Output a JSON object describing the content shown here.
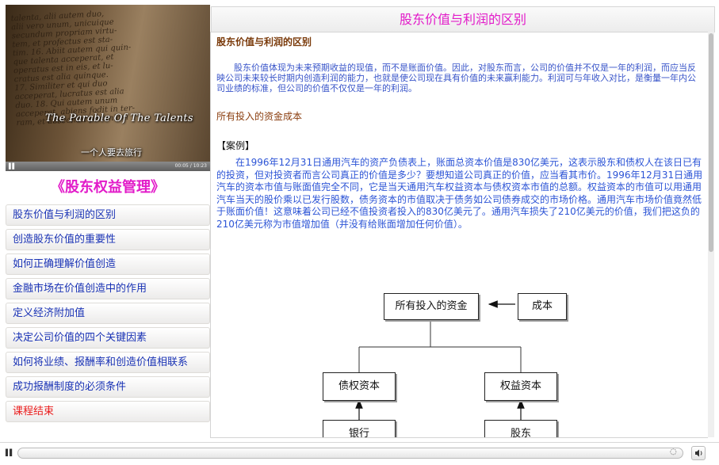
{
  "video": {
    "book_text": [
      "talenta, alii autem duo,",
      "alii vero unum, unicuique",
      "secundum propriam virtu-",
      "tem, et profectus est sta-",
      "tim. 16. Abiit autem qui quin-",
      "que talenta acceperat, et",
      "operatus est in eis, et lu-",
      "cratus est alia quinque.",
      "17. Similiter et qui duo",
      "acceperat, lucratus est alia",
      "duo. 18. Qui autem unum",
      "acceperat, abiens fodit in ter-",
      "ram, et abscondit pecuniam"
    ],
    "caption_en": "The Parable Of The Talents",
    "caption_cn": "一个人要去旅行",
    "time": "00:05 / 10:23"
  },
  "course_title": "《股东权益管理》",
  "menu": [
    {
      "label": "股东价值与利润的区别",
      "current": false
    },
    {
      "label": "创造股东价值的重要性",
      "current": false
    },
    {
      "label": "如何正确理解价值创造",
      "current": false
    },
    {
      "label": "金融市场在价值创造中的作用",
      "current": false
    },
    {
      "label": "定义经济附加值",
      "current": false
    },
    {
      "label": "决定公司价值的四个关键因素",
      "current": false
    },
    {
      "label": "如何将业绩、报酬率和创造价值相联系",
      "current": false
    },
    {
      "label": "成功报酬制度的必须条件",
      "current": false
    },
    {
      "label": "课程结束",
      "current": true
    }
  ],
  "header_title": "股东价值与利润的区别",
  "content": {
    "section_title": "股东价值与利润的区别",
    "para1": "股东价值体现为未来预期收益的现值，而不是账面价值。因此，对股东而言，公司的价值并不仅是一年的利润，而应当反映公司未来较长时期内创造利润的能力，也就是使公司现在具有价值的未来赢利能力。利润可与年收入对比，是衡量一年内公司业绩的标准，但公司的价值不仅仅是一年的利润。",
    "subheading": "所有投入的资金成本",
    "case_label": "【案例】",
    "para2": "在1996年12月31日通用汽车的资产负债表上，账面总资本价值是830亿美元，这表示股东和债权人在该日已有的投资，但对投资者而言公司真正的价值是多少？要想知道公司真正的价值，应当看其市价。1996年12月31日通用汽车的资本市值与账面值完全不同，它是当天通用汽车权益资本与债权资本市值的总额。权益资本的市值可以用通用汽车当天的股价乘以已发行股数，债务资本的市值取决于债务如公司债券成交的市场价格。通用汽车市场价值竟然低于账面价值！这意味着公司已经不值投资者投入的830亿美元了。通用汽车损失了210亿美元的价值，我们把这负的210亿美元称为市值增加值（并没有给账面增加任何价值）。",
    "diagram": {
      "top": "所有投入的资金",
      "cost": "成本",
      "debt": "债权资本",
      "equity": "权益资本",
      "bank": "银行",
      "shareholder": "股东"
    }
  },
  "icons": {
    "play_pause": "pause-icon",
    "volume": "speaker-icon",
    "loop": "loop-icon"
  }
}
